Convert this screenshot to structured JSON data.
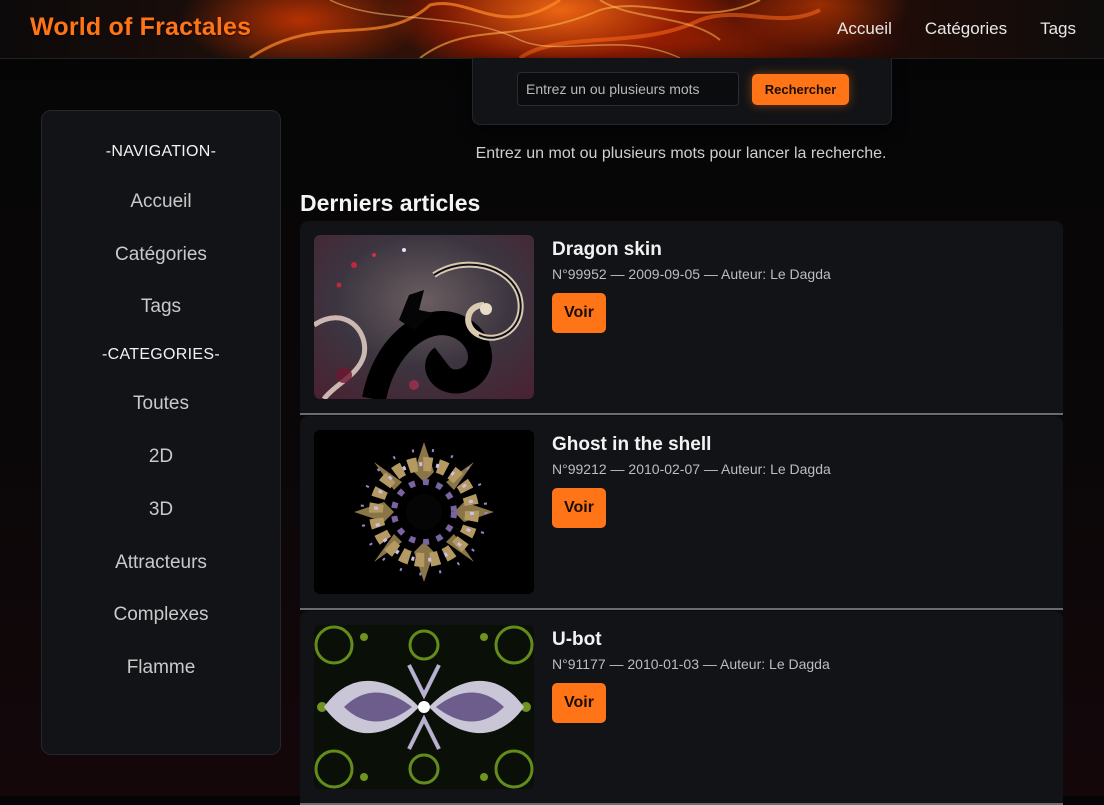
{
  "site": {
    "brand": "World of Fractales"
  },
  "topnav": {
    "items": [
      "Accueil",
      "Catégories",
      "Tags"
    ]
  },
  "search": {
    "placeholder": "Entrez un ou plusieurs mots",
    "button_label": "Rechercher",
    "hint": "Entrez un mot ou plusieurs mots pour lancer la recherche."
  },
  "sidebar": {
    "navigation_heading": "-NAVIGATION-",
    "navigation_items": [
      "Accueil",
      "Catégories",
      "Tags"
    ],
    "categories_heading": "-CATEGORIES-",
    "category_items": [
      "Toutes",
      "2D",
      "3D",
      "Attracteurs",
      "Complexes",
      "Flamme"
    ]
  },
  "articles_section": {
    "title": "Derniers articles",
    "items": [
      {
        "title": "Dragon skin",
        "meta": "N°99952 — 2009-09-05 — Auteur: Le Dagda",
        "button_label": "Voir"
      },
      {
        "title": "Ghost in the shell",
        "meta": "N°99212 — 2010-02-07 — Auteur: Le Dagda",
        "button_label": "Voir"
      },
      {
        "title": "U-bot",
        "meta": "N°91177 — 2010-01-03 — Auteur: Le Dagda",
        "button_label": "Voir"
      }
    ]
  },
  "colors": {
    "accent": "#ff7416",
    "panel": "#111317",
    "background": "#050506"
  }
}
